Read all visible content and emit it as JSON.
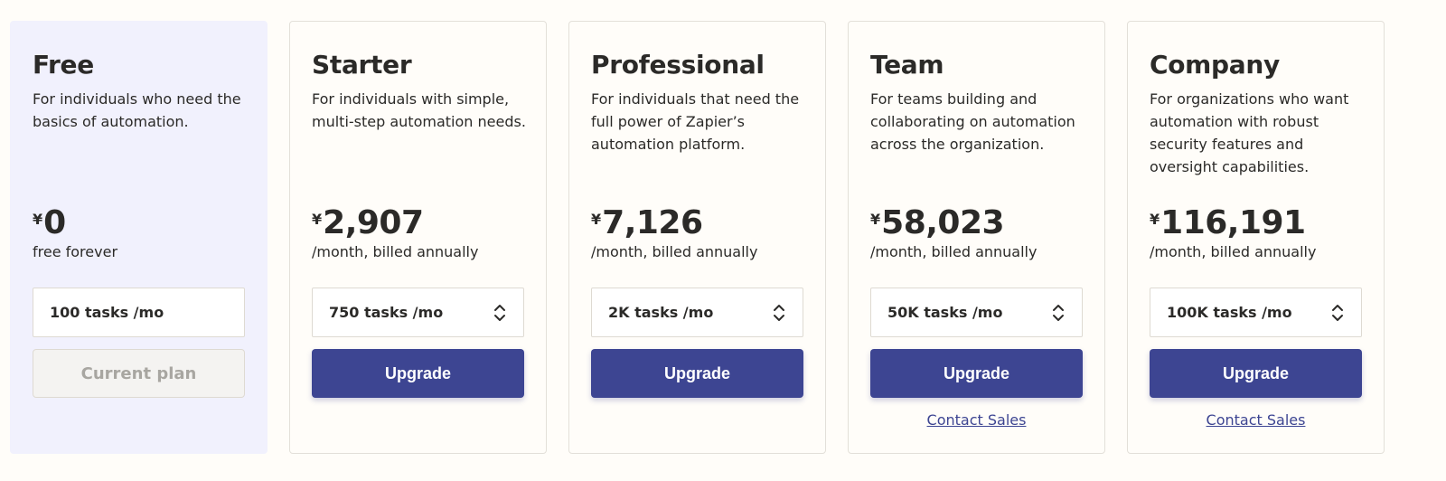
{
  "colors": {
    "accent": "#3d4592",
    "current_card_bg": "#f1f1fd",
    "page_bg": "#fffdf9",
    "text": "#2b2a28"
  },
  "plans": [
    {
      "name": "Free",
      "description": "For individuals who need the basics of automation.",
      "currency": "¥",
      "price": "0",
      "billing": "free forever",
      "tasks": "100 tasks /mo",
      "button": "Current plan"
    },
    {
      "name": "Starter",
      "description": "For individuals with simple, multi-step automation needs.",
      "currency": "¥",
      "price": "2,907",
      "billing": "/month, billed annually",
      "tasks": "750 tasks /mo",
      "tasks_icon": "up-down-chevron-icon",
      "button": "Upgrade"
    },
    {
      "name": "Professional",
      "description": "For individuals that need the full power of Zapier’s automation platform.",
      "currency": "¥",
      "price": "7,126",
      "billing": "/month, billed annually",
      "tasks": "2K tasks /mo",
      "tasks_icon": "up-down-chevron-icon",
      "button": "Upgrade"
    },
    {
      "name": "Team",
      "description": "For teams building and collaborating on automation across the organization.",
      "currency": "¥",
      "price": "58,023",
      "billing": "/month, billed annually",
      "tasks": "50K tasks /mo",
      "tasks_icon": "up-down-chevron-icon",
      "button": "Upgrade",
      "contact": "Contact Sales"
    },
    {
      "name": "Company",
      "description": "For organizations who want automation with robust security features and oversight capabilities.",
      "currency": "¥",
      "price": "116,191",
      "billing": "/month, billed annually",
      "tasks": "100K tasks /mo",
      "tasks_icon": "up-down-chevron-icon",
      "button": "Upgrade",
      "contact": "Contact Sales"
    }
  ]
}
